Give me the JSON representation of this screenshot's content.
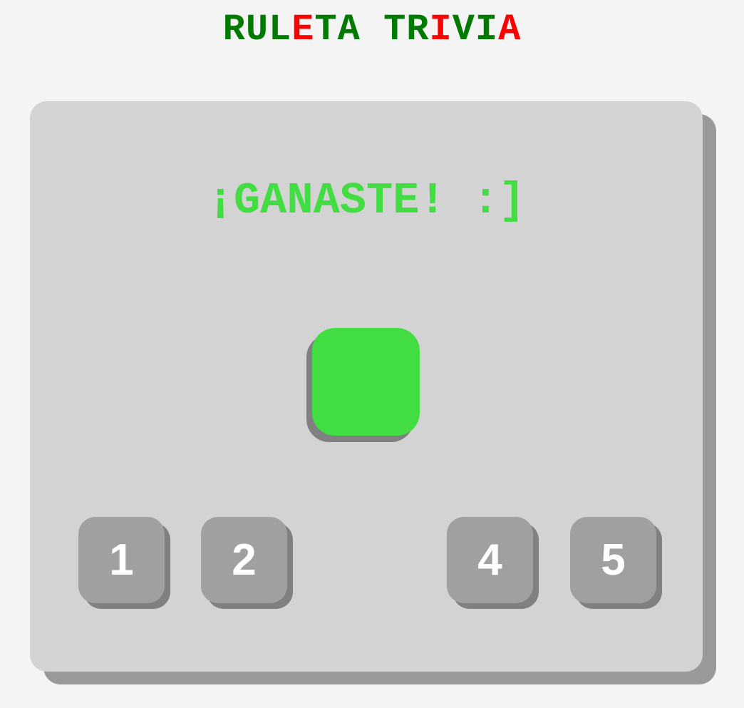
{
  "title": {
    "segments": [
      {
        "text": "RUL",
        "color": "#007a00"
      },
      {
        "text": "E",
        "color": "#ff0000"
      },
      {
        "text": "TA TR",
        "color": "#007a00"
      },
      {
        "text": "I",
        "color": "#ff0000"
      },
      {
        "text": "VI",
        "color": "#007a00"
      },
      {
        "text": "A",
        "color": "#ff0000"
      }
    ]
  },
  "game": {
    "message": "¡GANASTE! :]",
    "message_color": "#42dd42",
    "result_tile_color": "#42dd42",
    "buttons": [
      {
        "label": "1"
      },
      {
        "label": "2"
      },
      {
        "label": "4"
      },
      {
        "label": "5"
      }
    ]
  }
}
